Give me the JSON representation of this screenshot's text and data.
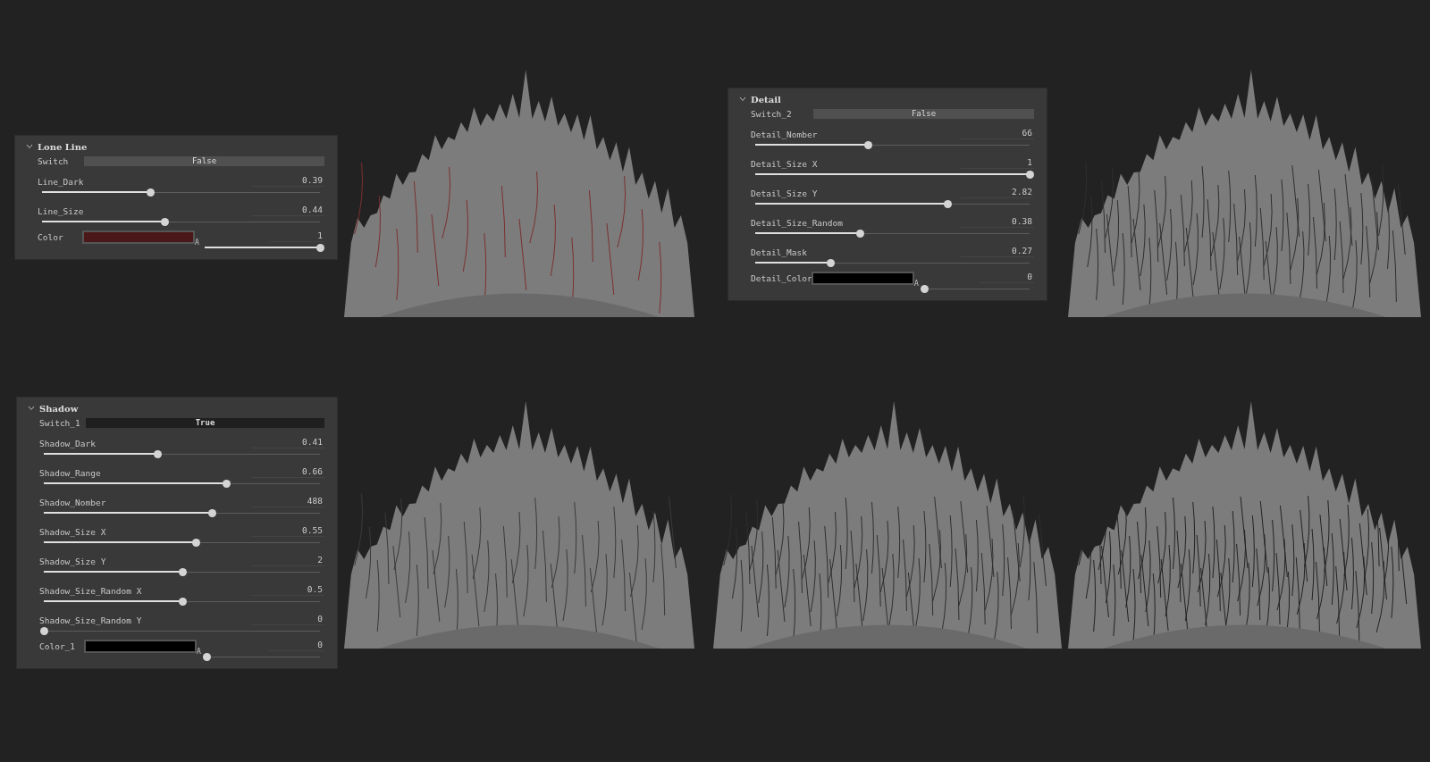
{
  "panels": [
    {
      "title": "Lone Line",
      "expanded": true,
      "rows": [
        {
          "kind": "switch",
          "label": "Switch",
          "value": "False",
          "on": false
        },
        {
          "kind": "slider",
          "label": "Line_Dark",
          "value": "0.39",
          "level": 0.39
        },
        {
          "kind": "slider",
          "label": "Line_Size",
          "value": "0.44",
          "level": 0.44
        },
        {
          "kind": "color",
          "label": "Color",
          "color": "#4a1818",
          "alpha_label": "A",
          "value": "1",
          "level": 1
        }
      ]
    },
    {
      "title": "Detail",
      "expanded": true,
      "rows": [
        {
          "kind": "switch",
          "label": "Switch_2",
          "value": "False",
          "on": false
        },
        {
          "kind": "slider",
          "label": "Detail_Nomber",
          "value": "66",
          "level": 0.41
        },
        {
          "kind": "slider",
          "label": "Detail_Size X",
          "value": "1",
          "level": 1
        },
        {
          "kind": "slider",
          "label": "Detail_Size Y",
          "value": "2.82",
          "level": 0.7
        },
        {
          "kind": "slider",
          "label": "Detail_Size_Random",
          "value": "0.38",
          "level": 0.38
        },
        {
          "kind": "slider",
          "label": "Detail_Mask",
          "value": "0.27",
          "level": 0.275
        },
        {
          "kind": "color",
          "label": "Detail_Color",
          "color": "#000000",
          "alpha_label": "A",
          "value": "0",
          "level": 0
        }
      ]
    },
    {
      "title": "Shadow",
      "expanded": true,
      "rows": [
        {
          "kind": "switch",
          "label": "Switch_1",
          "value": "True",
          "on": true
        },
        {
          "kind": "slider",
          "label": "Shadow_Dark",
          "value": "0.41",
          "level": 0.41
        },
        {
          "kind": "slider",
          "label": "Shadow_Range",
          "value": "0.66",
          "level": 0.66
        },
        {
          "kind": "slider",
          "label": "Shadow_Nomber",
          "value": "488",
          "level": 0.61
        },
        {
          "kind": "slider",
          "label": "Shadow_Size X",
          "value": "0.55",
          "level": 0.55
        },
        {
          "kind": "slider",
          "label": "Shadow_Size Y",
          "value": "2",
          "level": 0.5
        },
        {
          "kind": "slider",
          "label": "Shadow_Size_Random X",
          "value": "0.5",
          "level": 0.5
        },
        {
          "kind": "slider",
          "label": "Shadow_Size_Random Y",
          "value": "0",
          "level": 0
        },
        {
          "kind": "color",
          "label": "Color_1",
          "color": "#000000",
          "alpha_label": "A",
          "value": "0",
          "level": 0
        }
      ]
    }
  ]
}
